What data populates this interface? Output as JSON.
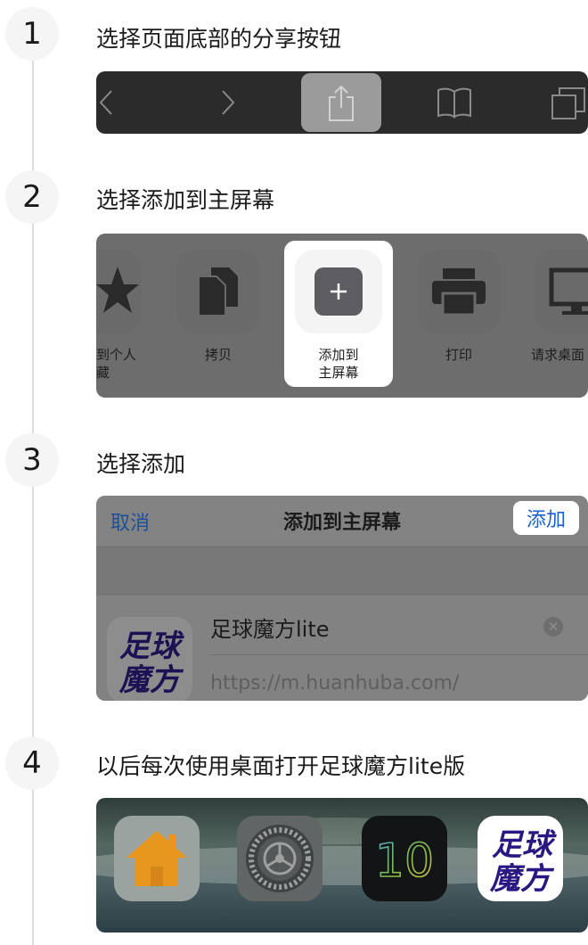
{
  "steps": [
    {
      "number": "1",
      "title": "选择页面底部的分享按钮"
    },
    {
      "number": "2",
      "title": "选择添加到主屏幕"
    },
    {
      "number": "3",
      "title": "选择添加"
    },
    {
      "number": "4",
      "title": "以后每次使用桌面打开足球魔方lite版"
    }
  ],
  "toolbar": {
    "icons": [
      "back-icon",
      "forward-icon",
      "share-icon",
      "bookmarks-icon",
      "tabs-icon"
    ],
    "highlight_color": "#9b9b9b"
  },
  "share_sheet": {
    "items": [
      {
        "icon": "star-icon",
        "label_line1": "到个人",
        "label_line2": "藏"
      },
      {
        "icon": "copy-icon",
        "label_line1": "拷贝",
        "label_line2": ""
      },
      {
        "icon": "plus-icon",
        "label_line1": "添加到",
        "label_line2": "主屏幕"
      },
      {
        "icon": "printer-icon",
        "label_line1": "打印",
        "label_line2": ""
      },
      {
        "icon": "desktop-icon",
        "label_line1": "请求桌面",
        "label_line2": ""
      }
    ]
  },
  "add_home": {
    "cancel_label": "取消",
    "title": "添加到主屏幕",
    "add_label": "添加",
    "app_name": "足球魔方lite",
    "url": "https://m.huanhuba.com/",
    "logo_line1": "足球",
    "logo_line2": "魔方",
    "accent": "#1a62d4"
  },
  "home_screen": {
    "icons": [
      "home-app-icon",
      "settings-app-icon",
      "ios10-app-icon",
      "zuqiu-mofang-app-icon"
    ],
    "ios10_text": "10",
    "logo_line1": "足球",
    "logo_line2": "魔方",
    "brand_color": "#2a1782"
  }
}
